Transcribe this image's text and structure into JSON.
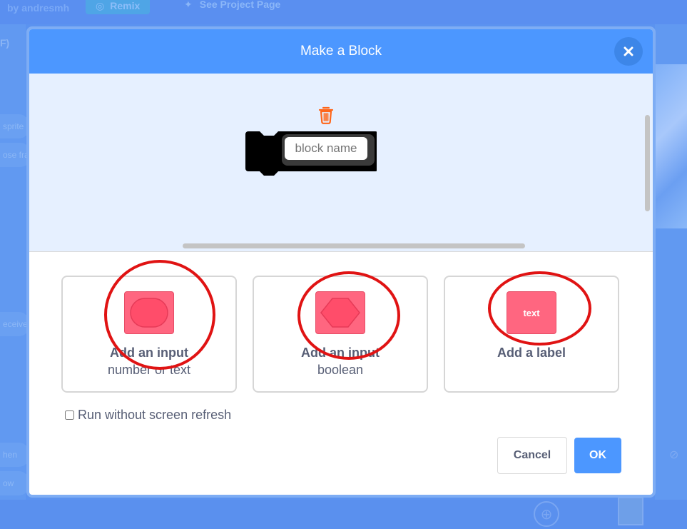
{
  "background": {
    "author_text": "by andresmh",
    "remix_label": "Remix",
    "see_project_label": "See Project Page",
    "left_chip_1": "sprite",
    "left_chip_2": "ose fra",
    "left_chip_3": "eceive",
    "left_chip_4": "hen",
    "left_chip_5": "ow",
    "header_fragment": "F)"
  },
  "modal": {
    "title": "Make a Block",
    "block_name_placeholder": "block name",
    "options": [
      {
        "title": "Add an input",
        "subtitle": "number or text",
        "icon": "number-input-icon"
      },
      {
        "title": "Add an input",
        "subtitle": "boolean",
        "icon": "boolean-input-icon"
      },
      {
        "title": "Add a label",
        "subtitle": "",
        "icon": "label-icon",
        "icon_text": "text"
      }
    ],
    "run_without_refresh_label": "Run without screen refresh",
    "run_without_refresh_checked": false,
    "cancel_label": "Cancel",
    "ok_label": "OK"
  },
  "colors": {
    "header": "#4c97ff",
    "preview_bg": "#e6f0ff",
    "input_icon": "#ff6680",
    "highlight": "#e01313",
    "delete_icon": "#ff661a"
  }
}
